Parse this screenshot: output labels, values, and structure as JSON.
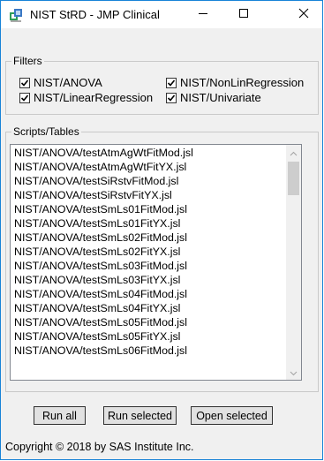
{
  "window": {
    "title": "NIST StRD - JMP Clinical",
    "icon": "jmp-clinical-app-icon",
    "controls": [
      "minimize-icon",
      "maximize-icon",
      "close-icon"
    ]
  },
  "filters": {
    "label": "Filters",
    "items": [
      {
        "label": "NIST/ANOVA",
        "checked": true
      },
      {
        "label": "NIST/NonLinRegression",
        "checked": true
      },
      {
        "label": "NIST/LinearRegression",
        "checked": true
      },
      {
        "label": "NIST/Univariate",
        "checked": true
      }
    ]
  },
  "scripts": {
    "label": "Scripts/Tables",
    "items": [
      "NIST/ANOVA/testAtmAgWtFitMod.jsl",
      "NIST/ANOVA/testAtmAgWtFitYX.jsl",
      "NIST/ANOVA/testSiRstvFitMod.jsl",
      "NIST/ANOVA/testSiRstvFitYX.jsl",
      "NIST/ANOVA/testSmLs01FitMod.jsl",
      "NIST/ANOVA/testSmLs01FitYX.jsl",
      "NIST/ANOVA/testSmLs02FitMod.jsl",
      "NIST/ANOVA/testSmLs02FitYX.jsl",
      "NIST/ANOVA/testSmLs03FitMod.jsl",
      "NIST/ANOVA/testSmLs03FitYX.jsl",
      "NIST/ANOVA/testSmLs04FitMod.jsl",
      "NIST/ANOVA/testSmLs04FitYX.jsl",
      "NIST/ANOVA/testSmLs05FitMod.jsl",
      "NIST/ANOVA/testSmLs05FitYX.jsl",
      "NIST/ANOVA/testSmLs06FitMod.jsl"
    ]
  },
  "buttons": {
    "run_all": "Run all",
    "run_selected": "Run selected",
    "open_selected": "Open selected"
  },
  "footer": {
    "copyright": "Copyright © 2018 by SAS Institute Inc."
  },
  "colors": {
    "window_border": "#1883d7",
    "client_background": "#f0f0f0",
    "button_face": "#e1e1e1"
  }
}
